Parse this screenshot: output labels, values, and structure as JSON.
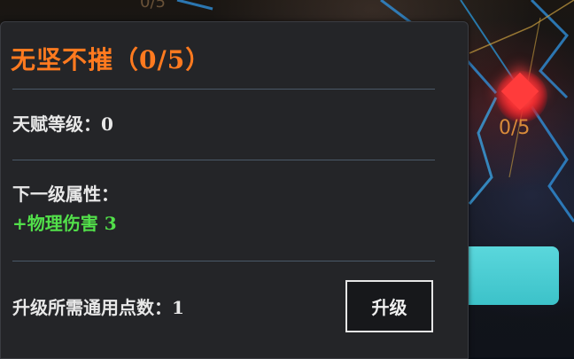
{
  "scene": {
    "node_progress": "0/5",
    "top_node_progress": "0/5"
  },
  "tooltip": {
    "title": "无坚不摧（0/5）",
    "talent_level_label": "天赋等级：0",
    "next_level_heading": "下一级属性：",
    "next_level_bonus": "+物理伤害  3",
    "cost_label": "升级所需通用点数：1",
    "upgrade_button": "升级"
  },
  "colors": {
    "title": "#ff7a1f",
    "bonus": "#52e04a",
    "node": "#ff3b3b",
    "button_accent": "#4fd0d6"
  }
}
